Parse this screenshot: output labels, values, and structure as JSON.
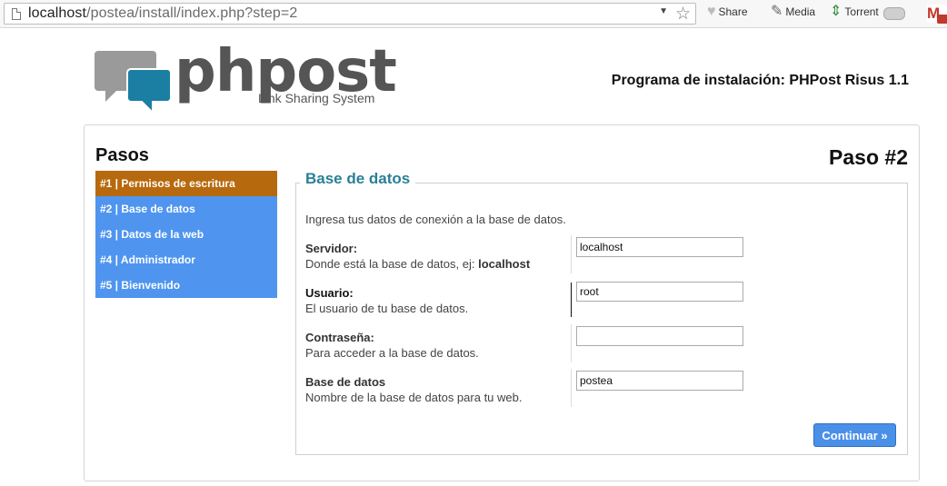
{
  "browser": {
    "url_host": "localhost",
    "url_path": "/postea/install/index.php?step=2",
    "toolbar": {
      "share": "Share",
      "media": "Media",
      "torrent": "Torrent",
      "gmail": "M"
    }
  },
  "header": {
    "logo_text": "phpost",
    "logo_tagline": "Link Sharing System",
    "title": "Programa de instalación: PHPost Risus 1.1"
  },
  "sidebar": {
    "title": "Pasos",
    "steps": [
      {
        "label": "#1 | Permisos de escritura",
        "active": true
      },
      {
        "label": "#2 | Base de datos",
        "active": false
      },
      {
        "label": "#3 | Datos de la web",
        "active": false
      },
      {
        "label": "#4 | Administrador",
        "active": false
      },
      {
        "label": "#5 | Bienvenido",
        "active": false
      }
    ]
  },
  "main": {
    "step_title": "Paso #2",
    "section_title": "Base de datos",
    "intro": "Ingresa tus datos de conexión a la base de datos.",
    "fields": [
      {
        "label": "Servidor:",
        "help": "Donde está la base de datos, ej: ",
        "help_bold": "localhost",
        "value": "localhost"
      },
      {
        "label": "Usuario:",
        "help": "El usuario de tu base de datos.",
        "help_bold": "",
        "value": "root"
      },
      {
        "label": "Contraseña:",
        "help": "Para acceder a la base de datos.",
        "help_bold": "",
        "value": ""
      },
      {
        "label": "Base de datos",
        "help": "Nombre de la base de datos para tu web.",
        "help_bold": "",
        "value": "postea"
      }
    ],
    "submit_label": "Continuar »"
  },
  "colors": {
    "step_active": "#b7690d",
    "step_inactive": "#4f95ef",
    "section_title": "#2a7f97",
    "button": "#4a90e8",
    "logo_bubble": "#1a7fa3",
    "logo_grey": "#9a9a9a"
  }
}
